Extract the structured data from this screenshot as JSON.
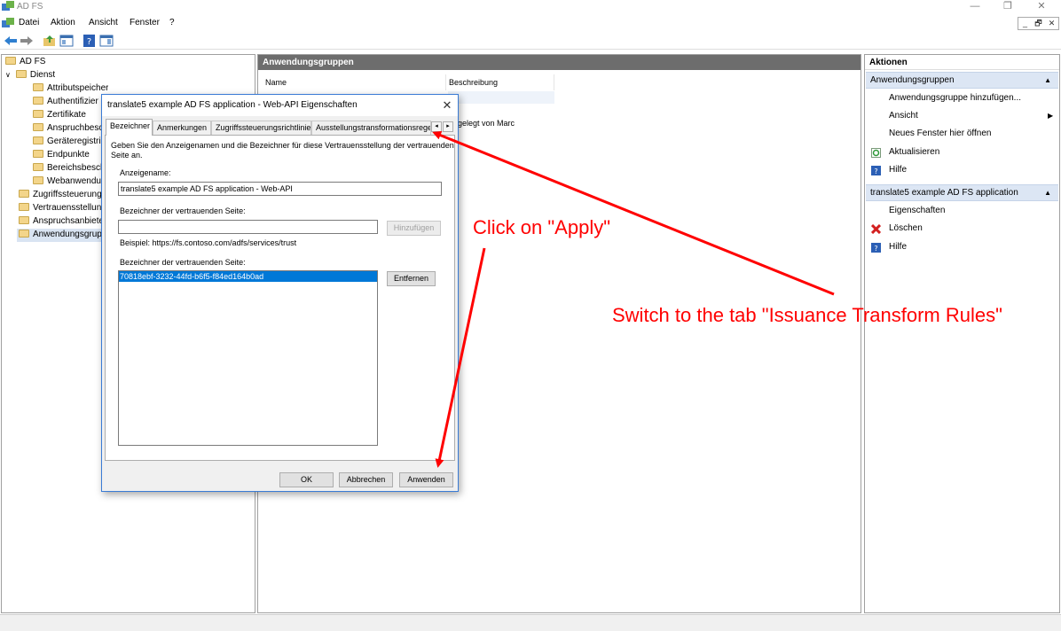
{
  "window": {
    "title": "AD FS",
    "controls": [
      "—",
      "❐",
      "✕"
    ]
  },
  "menu": {
    "items": [
      "Datei",
      "Aktion",
      "Ansicht",
      "Fenster",
      "?"
    ],
    "mdi_controls": [
      "_",
      "🗗",
      "✕"
    ]
  },
  "toolbar": {
    "icons": [
      "back-arrow-icon",
      "forward-arrow-icon",
      "up-folder-icon",
      "console-tree-icon",
      "help-icon",
      "action-pane-icon"
    ]
  },
  "tree": {
    "root": "AD FS",
    "service": "Dienst",
    "children": [
      "Attributspeicher",
      "Authentifizier",
      "Zertifikate",
      "Anspruchbesc",
      "Geräteregistrie",
      "Endpunkte",
      "Bereichsbesch",
      "Webanwendu"
    ],
    "top_level": [
      "Zugriffssteuerung",
      "Vertrauensstellung",
      "Anspruchsanbiete",
      "Anwendungsgrup"
    ]
  },
  "center": {
    "header": "Anwendungsgruppen",
    "columns": [
      "Name",
      "Beschreibung"
    ],
    "row_description_fragment": "gelegt von Marc"
  },
  "actions": {
    "header": "Aktionen",
    "section1": {
      "title": "Anwendungsgruppen",
      "items": [
        "Anwendungsgruppe hinzufügen...",
        "Ansicht",
        "Neues Fenster hier öffnen",
        "Aktualisieren",
        "Hilfe"
      ]
    },
    "section2": {
      "title": "translate5 example AD FS application",
      "items": [
        "Eigenschaften",
        "Löschen",
        "Hilfe"
      ]
    }
  },
  "dialog": {
    "title": "translate5 example AD FS application - Web-API Eigenschaften",
    "close": "✕",
    "tabs": [
      "Bezeichner",
      "Anmerkungen",
      "Zugriffssteuerungsrichtlinie",
      "Ausstellungstransformationsregeln"
    ],
    "tab_scroll": [
      "◂",
      "▸"
    ],
    "description": "Geben Sie den Anzeigenamen und die Bezeichner für diese Vertrauensstellung der vertrauenden Seite an.",
    "description_line1": "Geben Sie den Anzeigenamen und die Bezeichner für diese Vertrauensstellung der vertrauenden",
    "description_line2": "Seite an.",
    "display_name_label": "Anzeigename:",
    "display_name_value": "translate5 example AD FS application - Web-API",
    "identifier_label": "Bezeichner der vertrauenden Seite:",
    "identifier_input_value": "",
    "add_button": "Hinzufügen",
    "example_text": "Beispiel: https://fs.contoso.com/adfs/services/trust",
    "identifiers_list_label": "Bezeichner der vertrauenden Seite:",
    "identifiers": [
      "70818ebf-3232-44fd-b6f5-f84ed164b0ad"
    ],
    "remove_button": "Entfernen",
    "ok_button": "OK",
    "cancel_button": "Abbrechen",
    "apply_button": "Anwenden"
  },
  "annotations": {
    "apply_hint": "Click on \"Apply\"",
    "tab_hint": "Switch to the tab \"Issuance Transform Rules\"",
    "color": "#ff0000"
  }
}
